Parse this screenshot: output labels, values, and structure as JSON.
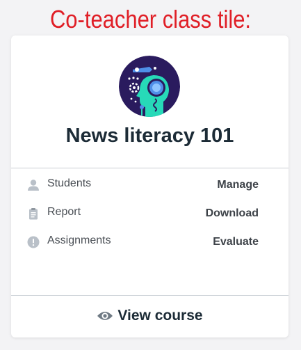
{
  "caption": "Co-teacher class tile:",
  "card": {
    "title": "News literacy 101",
    "avatar_icon": "news-literacy-course-illustration",
    "rows": [
      {
        "icon": "person-icon",
        "label": "Students",
        "action": "Manage"
      },
      {
        "icon": "clipboard-icon",
        "label": "Report",
        "action": "Download"
      },
      {
        "icon": "exclamation-circle-icon",
        "label": "Assignments",
        "action": "Evaluate"
      }
    ],
    "footer": {
      "icon": "eye-icon",
      "label": "View course"
    }
  },
  "colors": {
    "caption": "#e01e26",
    "avatar_bg": "#2a1b5e",
    "avatar_accent": "#27d9b8",
    "title": "#1c2b36",
    "icon_gray": "#b9c0c8"
  }
}
